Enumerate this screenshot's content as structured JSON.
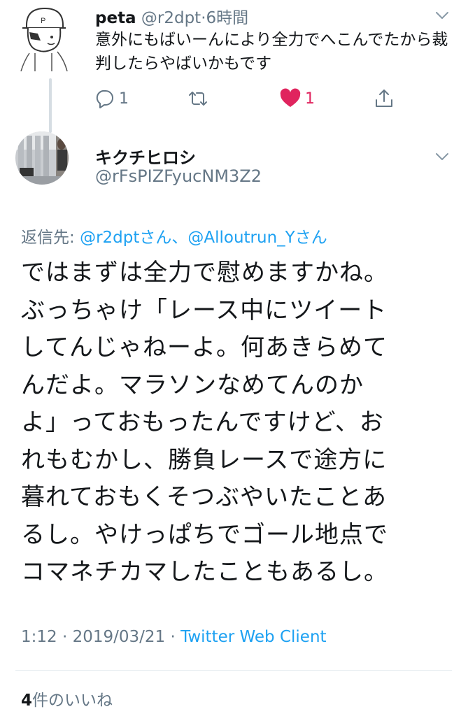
{
  "parent_tweet": {
    "display_name": "peta",
    "handle": "@r2dpt",
    "separator": "·",
    "time_ago": "6時間",
    "text": "意外にもばいーんにより全力でへこんでたから裁判したらやばいかもです",
    "reply_count": "1",
    "like_count": "1",
    "icons": [
      "reply-icon",
      "retweet-icon",
      "heart-icon",
      "share-icon",
      "chevron-down-icon"
    ]
  },
  "main_tweet": {
    "display_name": "キクチヒロシ",
    "handle": "@rFsPIZFyucNM3Z2",
    "reply_to": {
      "prefix": "返信先: ",
      "user1": "@r2dptさん",
      "separator": "、",
      "user2": "@Alloutrun_Yさん"
    },
    "text_lines": [
      "ではまずは全力で慰めますかね。",
      "ぶっちゃけ「レース中にツイート",
      "してんじゃねーよ。何あきらめて",
      "んだよ。マラソンなめてんのか",
      "よ」っておもったんですけど、お",
      "れもむかし、勝負レースで途方に",
      "暮れておもくそつぶやいたことあ",
      "るし。やけっぱちでゴール地点で",
      "コマネチカマしたこともあるし。"
    ],
    "time": "1:12",
    "date": "2019/03/21",
    "separator": "·",
    "client": "Twitter Web Client",
    "likes_count": "4",
    "likes_label": "件のいいね"
  },
  "colors": {
    "link": "#1da1f2",
    "muted": "#657786",
    "like": "#e0245e",
    "text": "#14171a"
  }
}
